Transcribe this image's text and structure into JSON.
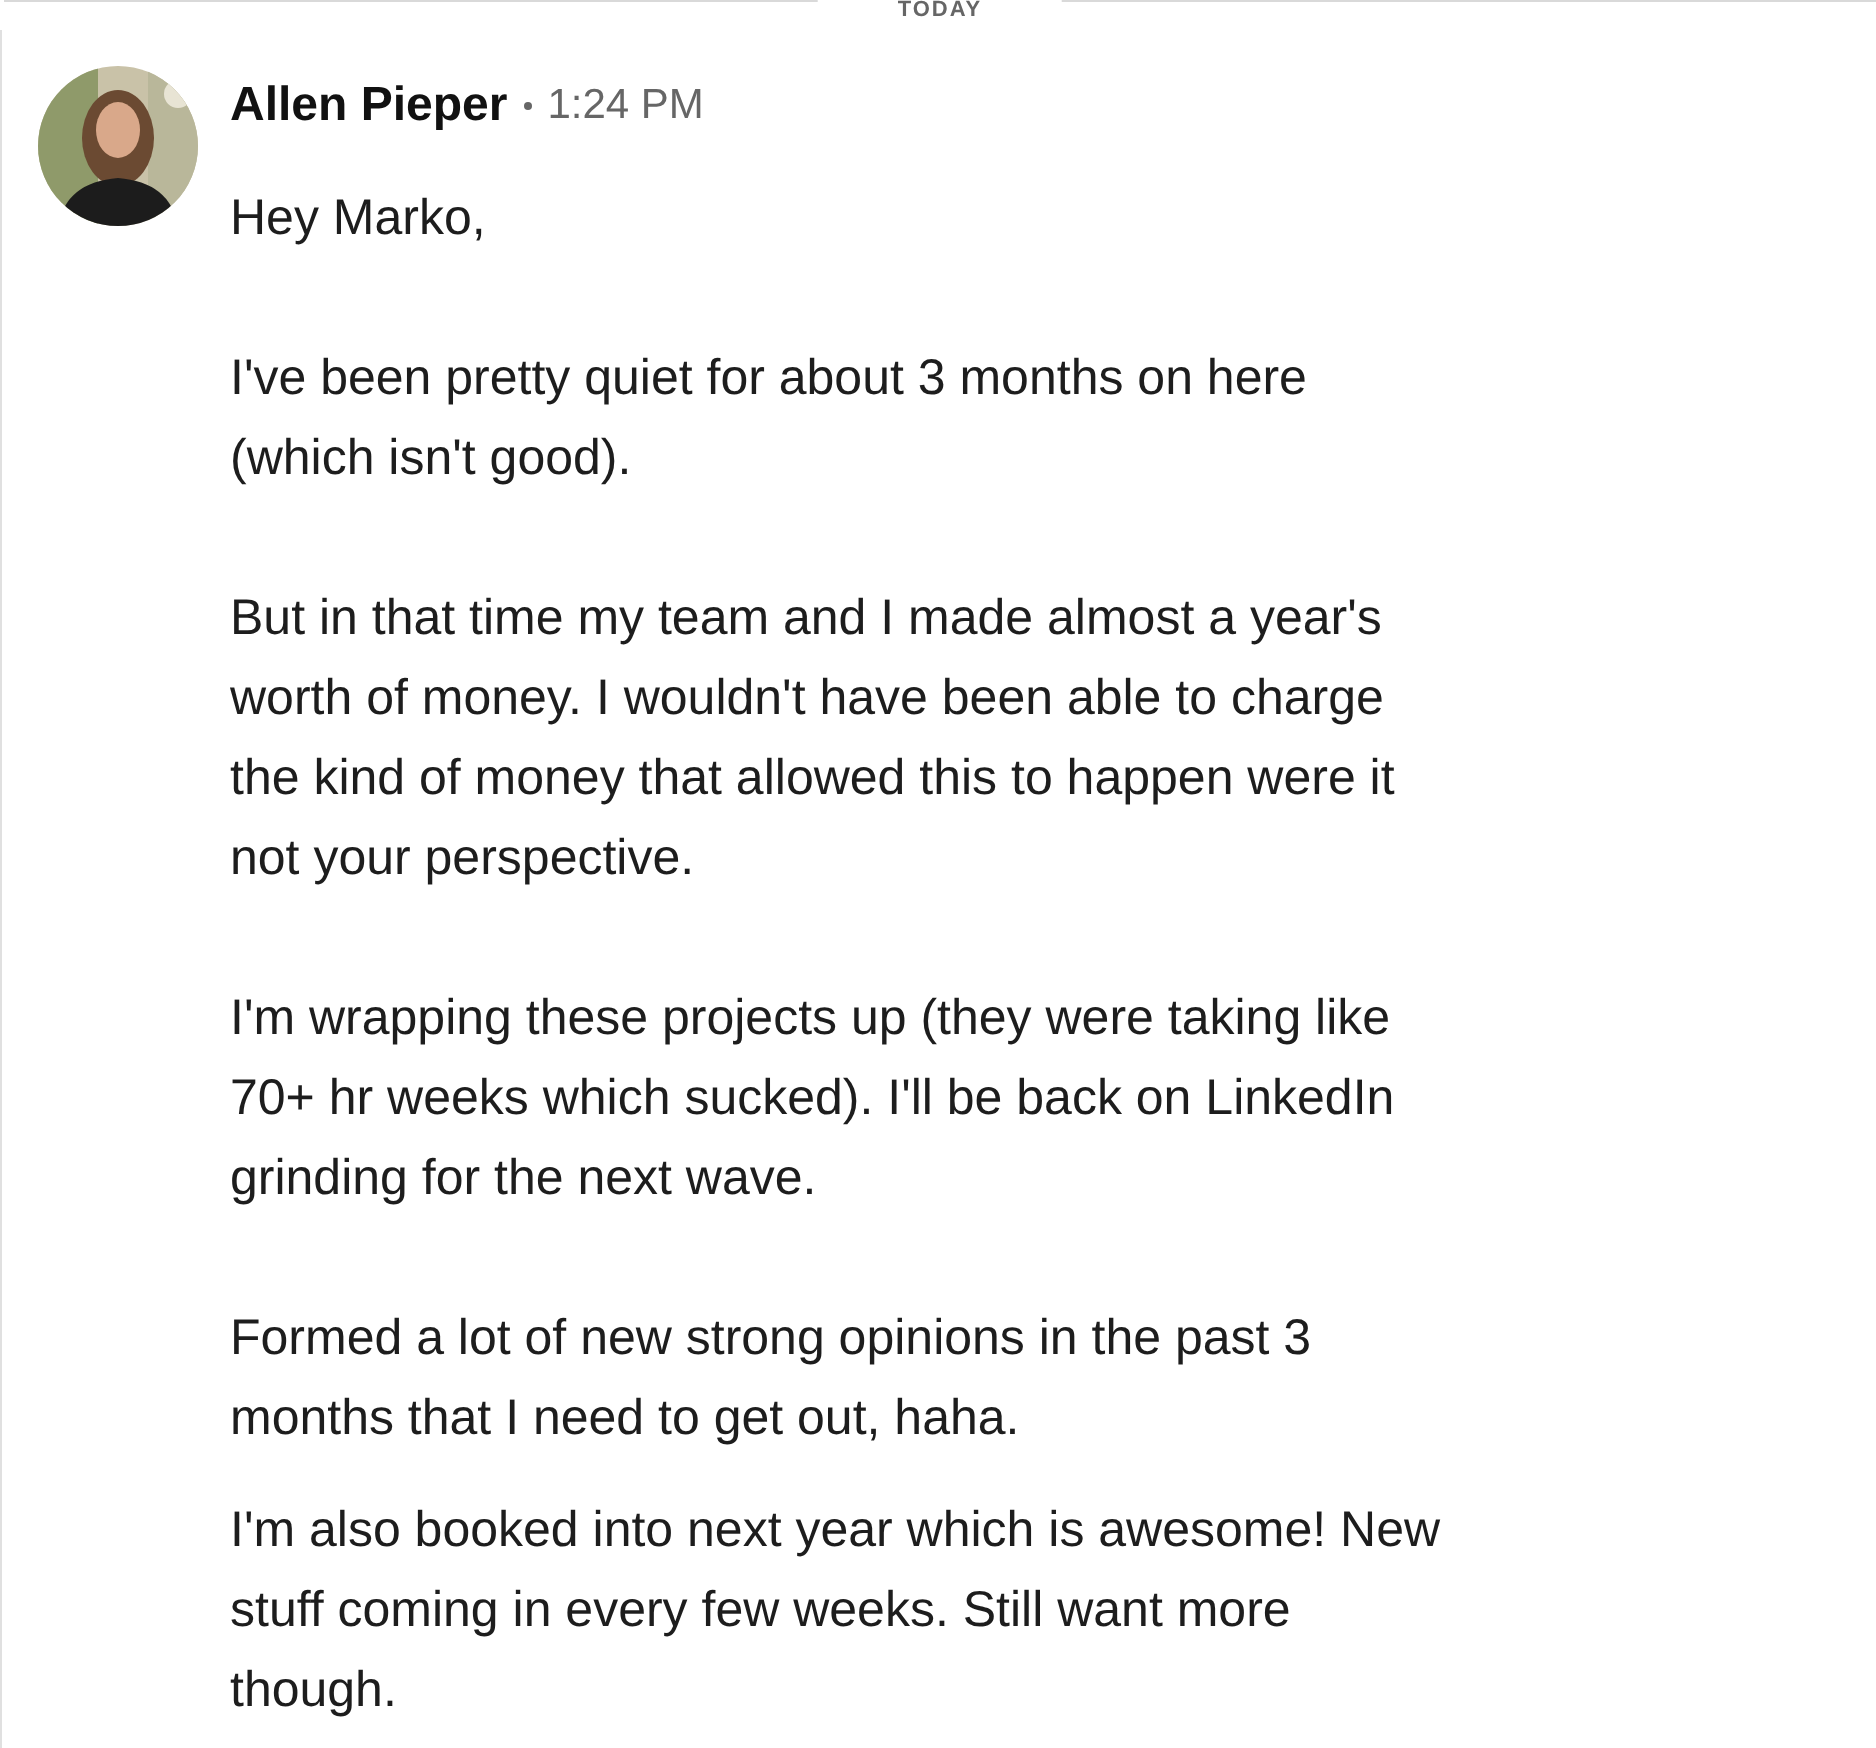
{
  "day_divider": "TODAY",
  "sender": {
    "name": "Allen Pieper",
    "time": "1:24 PM"
  },
  "messages": [
    {
      "paragraphs": [
        [
          "Hey Marko,"
        ],
        [
          "I've been pretty quiet for about 3 months on here",
          "(which isn't good)."
        ],
        [
          "But in that time my team and I made almost a year's",
          "worth of money. I wouldn't have been able to charge",
          "the kind of money that allowed this to happen were it",
          "not your perspective."
        ],
        [
          "I'm wrapping these projects up (they were taking like",
          "70+ hr weeks which sucked). I'll be back on LinkedIn",
          "grinding for the next wave."
        ],
        [
          "Formed a lot of new strong opinions in the past 3",
          "months that I need to get out, haha."
        ]
      ]
    },
    {
      "paragraphs": [
        [
          "I'm also booked into next year which is awesome! New",
          "stuff coming in every few weeks. Still want more",
          "though."
        ]
      ]
    }
  ]
}
